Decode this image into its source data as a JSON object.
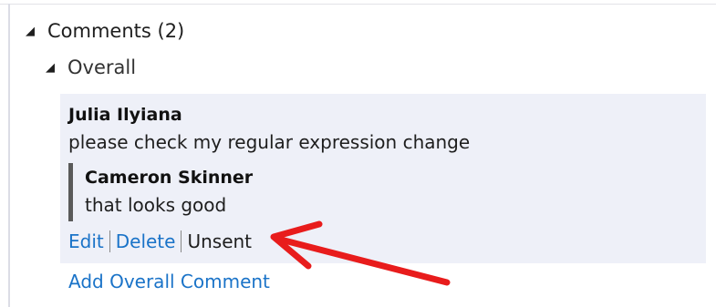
{
  "tree": {
    "comments_label": "Comments (2)",
    "overall_label": "Overall"
  },
  "thread": {
    "author": "Julia Ilyiana",
    "text": "please check my regular expression change",
    "reply": {
      "author": "Cameron Skinner",
      "text": "that looks good"
    },
    "actions": {
      "edit": "Edit",
      "delete": "Delete",
      "status": "Unsent"
    }
  },
  "add_comment_label": "Add Overall Comment",
  "colors": {
    "link": "#1a73c8",
    "card_bg": "#eef0f8",
    "annotation_arrow": "#e81c1c"
  }
}
